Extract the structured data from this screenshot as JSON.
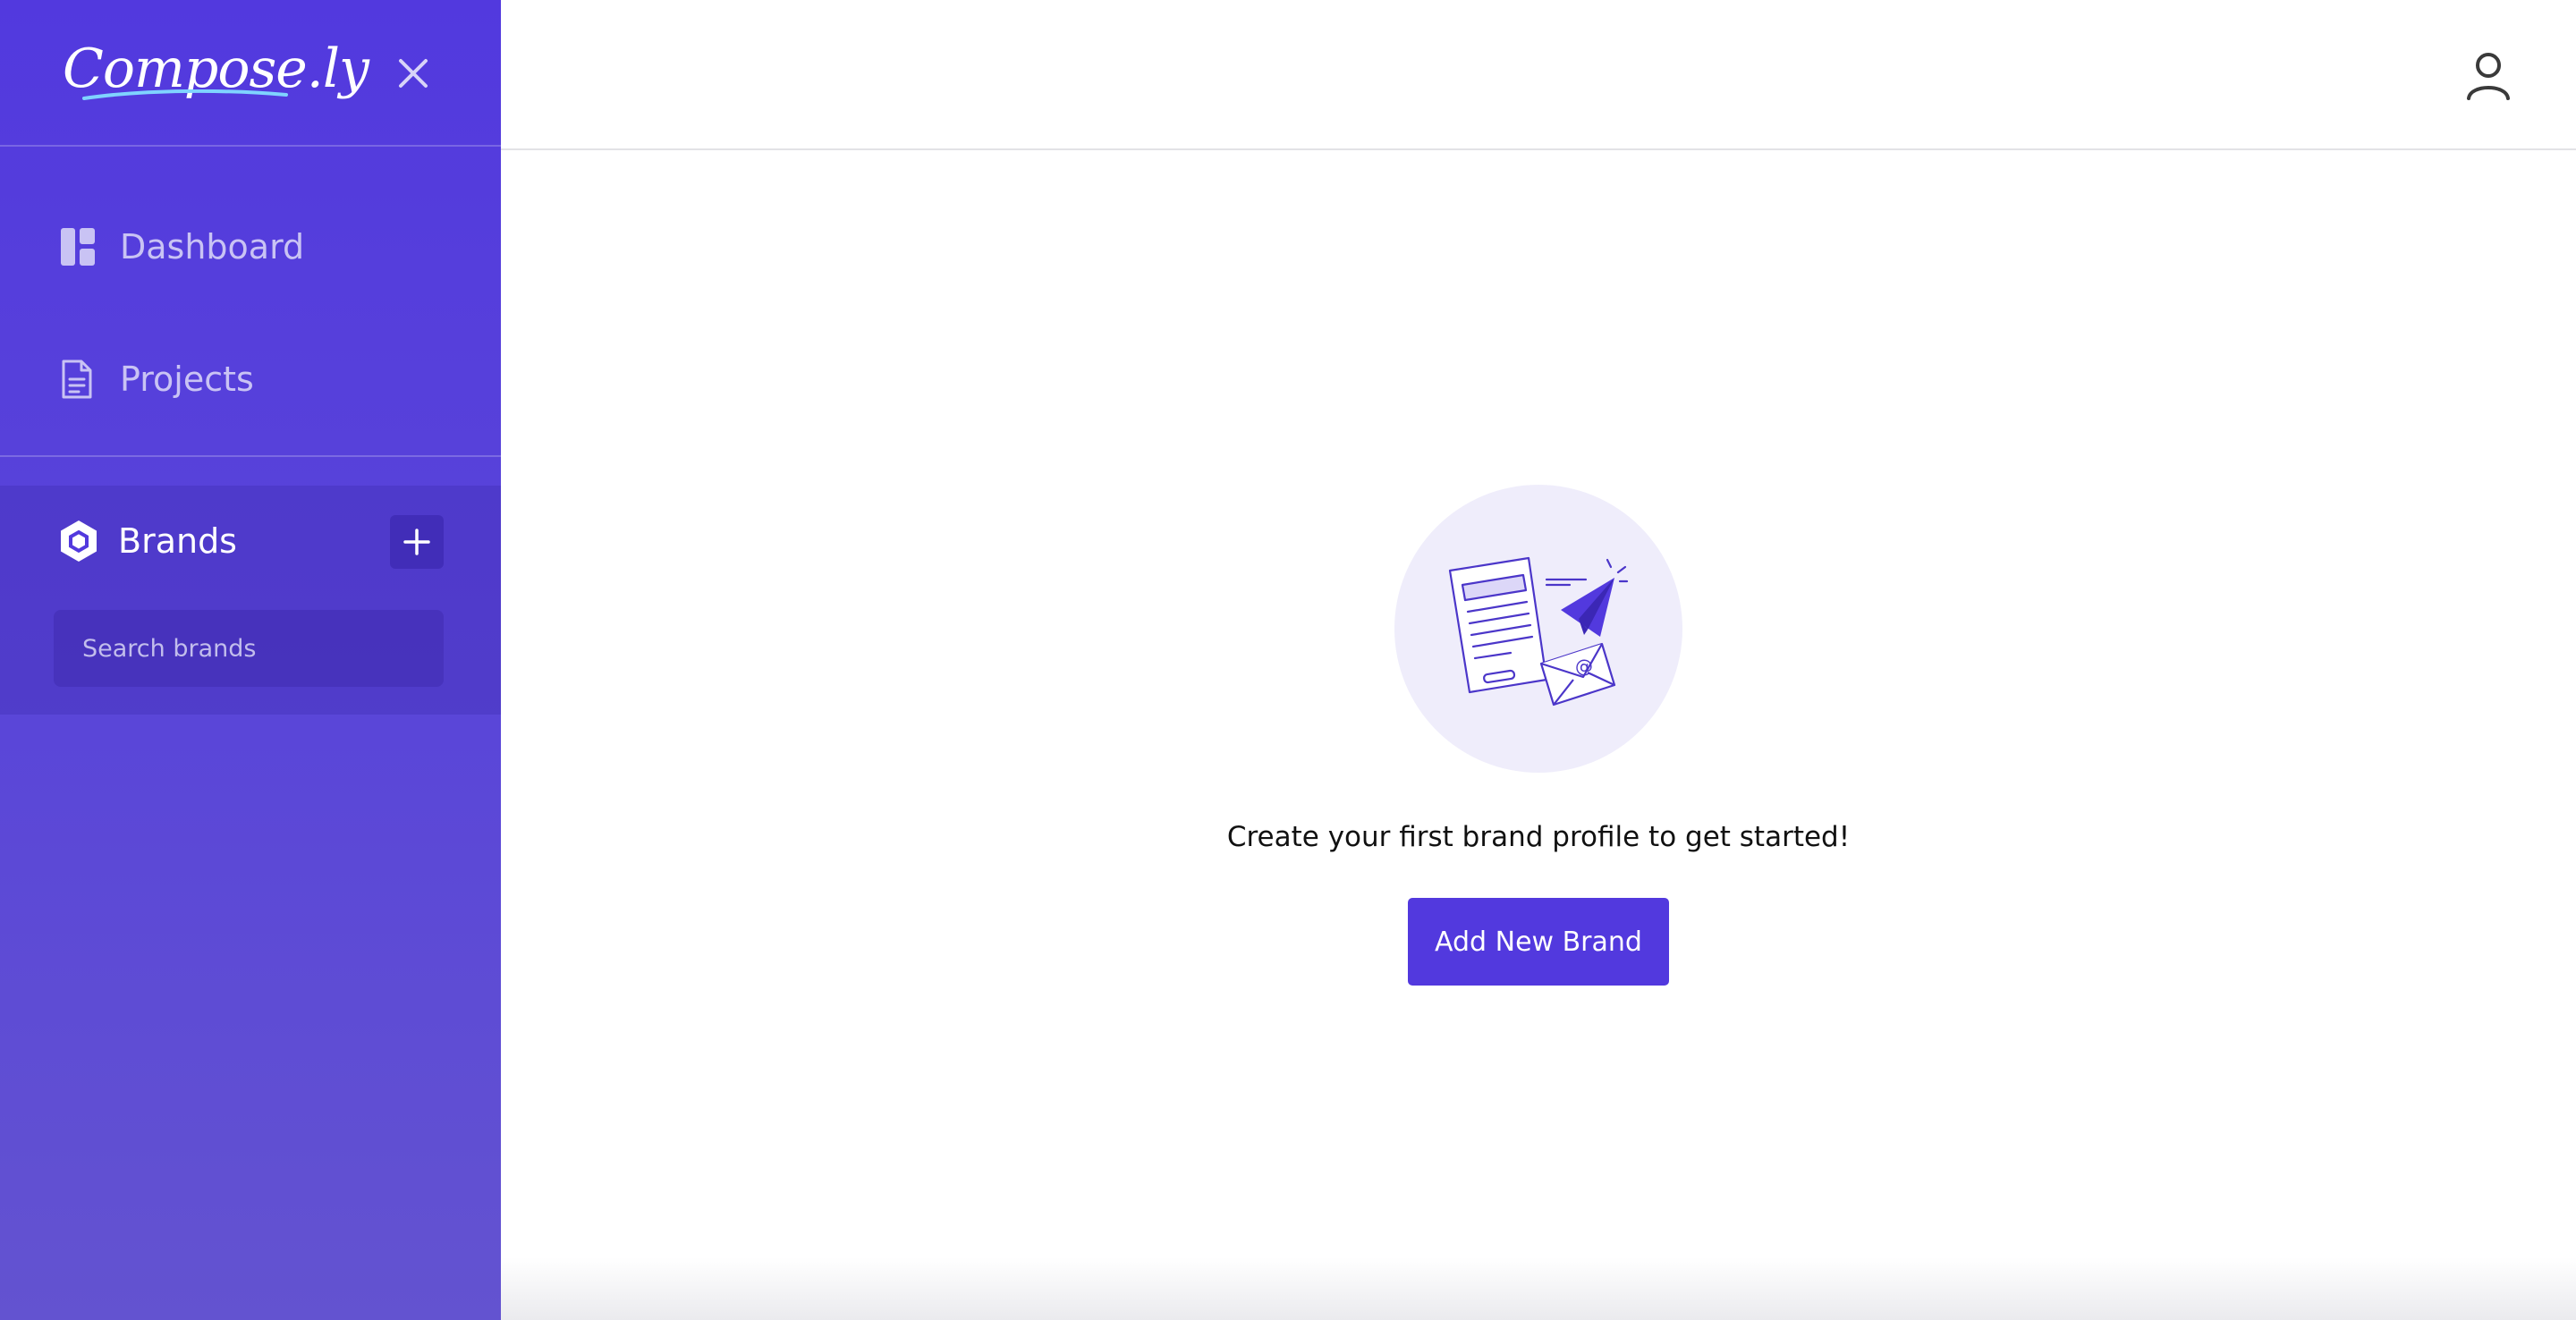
{
  "sidebar": {
    "logo_text": "Compose.ly",
    "close_icon": "close-icon",
    "nav": [
      {
        "label": "Dashboard",
        "icon": "dashboard-icon"
      },
      {
        "label": "Projects",
        "icon": "document-icon"
      }
    ],
    "brands": {
      "label": "Brands",
      "icon": "hexagon-icon",
      "add_icon": "plus-icon",
      "search_placeholder": "Search brands"
    }
  },
  "topbar": {
    "user_icon": "user-icon"
  },
  "empty_state": {
    "illustration": "documents-paper-plane-illustration",
    "message": "Create your first brand profile to get started!",
    "button_label": "Add New Brand"
  },
  "colors": {
    "brand": "#5239de",
    "sidebar_bottom": "#6353d0",
    "illustration_bg": "#efedfb"
  }
}
